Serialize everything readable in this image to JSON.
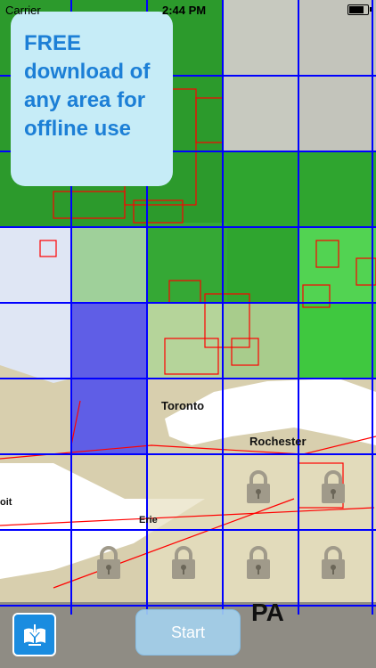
{
  "status_bar": {
    "carrier": "Carrier",
    "time": "2:44 PM",
    "battery_level": 0.9
  },
  "promo": {
    "text": "FREE download of any area for offline use"
  },
  "map": {
    "labels": {
      "toronto": "Toronto",
      "rochester": "Rochester",
      "erie": "Erie",
      "detroit_partial": "oit",
      "pa": "PA"
    },
    "colors": {
      "grid_line": "#0000ff",
      "chart_boundary": "#ff0000",
      "selected_tile": "#4a4af0",
      "lock_icon": "#a09a8a"
    }
  },
  "bottom_bar": {
    "download_icon": "download-icon",
    "start_label": "Start"
  }
}
